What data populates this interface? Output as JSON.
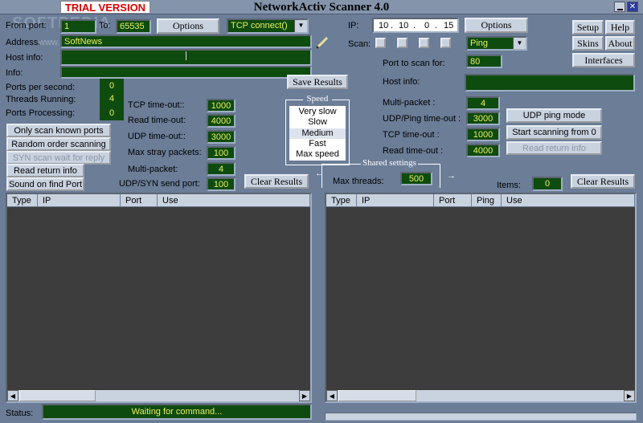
{
  "window": {
    "title": "NetworkActiv Scanner 4.0",
    "trial_badge": "TRIAL VERSION",
    "watermark": "SOFTPEDIA"
  },
  "left_top": {
    "from_port_label": "From port:",
    "from_port_value": "1",
    "to_label": "To:",
    "to_value": "65535",
    "options_label": "Options",
    "method_value": "TCP connect()",
    "address_label": "Address:",
    "address_hint": "www.so",
    "address_value": "SoftNews",
    "host_info_label": "Host info:",
    "info_label": "Info:"
  },
  "stats": {
    "pps_label": "Ports per second:",
    "pps_value": "0",
    "threads_label": "Threads Running:",
    "threads_value": "4",
    "processing_label": "Ports Processing:",
    "processing_value": "0"
  },
  "scan_buttons": [
    "Only scan known ports",
    "Random order scanning",
    "SYN scan wait for reply",
    "Read return info",
    "Sound on find Port"
  ],
  "tcp_settings": [
    {
      "label": "TCP time-out::",
      "value": "1000"
    },
    {
      "label": "Read time-out:",
      "value": "4000"
    },
    {
      "label": "UDP time-out::",
      "value": "3000"
    },
    {
      "label": "Max stray packets:",
      "value": "100"
    },
    {
      "label": "Multi-packet:",
      "value": "4"
    },
    {
      "label": "UDP/SYN send port:",
      "value": "100"
    }
  ],
  "save_results_label": "Save Results",
  "clear_results_label": "Clear Results",
  "speed": {
    "title": "Speed",
    "options": [
      "Very slow",
      "Slow",
      "Medium",
      "Fast",
      "Max speed"
    ],
    "selected": "Medium"
  },
  "shared": {
    "title": "Shared settings",
    "max_threads_label": "Max threads:",
    "max_threads_value": "500"
  },
  "right_top": {
    "ip_label": "IP:",
    "ip": [
      "10",
      "10",
      "0",
      "15"
    ],
    "options_label": "Options",
    "scan_label": "Scan:",
    "ping_value": "Ping",
    "port_label": "Port to scan for:",
    "port_value": "80",
    "host_info_label": "Host info:"
  },
  "right_settings": [
    {
      "label": "Multi-packet :",
      "value": "4"
    },
    {
      "label": "UDP/Ping time-out :",
      "value": "3000"
    },
    {
      "label": "TCP time-out :",
      "value": "1000"
    },
    {
      "label": "Read time-out :",
      "value": "4000"
    }
  ],
  "right_buttons": [
    "UDP ping mode",
    "Start scanning from 0",
    "Read return info"
  ],
  "menu": {
    "setup": "Setup",
    "help": "Help",
    "skins": "Skins",
    "about": "About",
    "interfaces": "Interfaces"
  },
  "items_label": "Items:",
  "items_value": "0",
  "left_table_headers": [
    "Type",
    "IP",
    "Port",
    "Use"
  ],
  "right_table_headers": [
    "Type",
    "IP",
    "Port",
    "Ping",
    "Use"
  ],
  "status": {
    "label": "Status:",
    "text": "Waiting for command..."
  }
}
